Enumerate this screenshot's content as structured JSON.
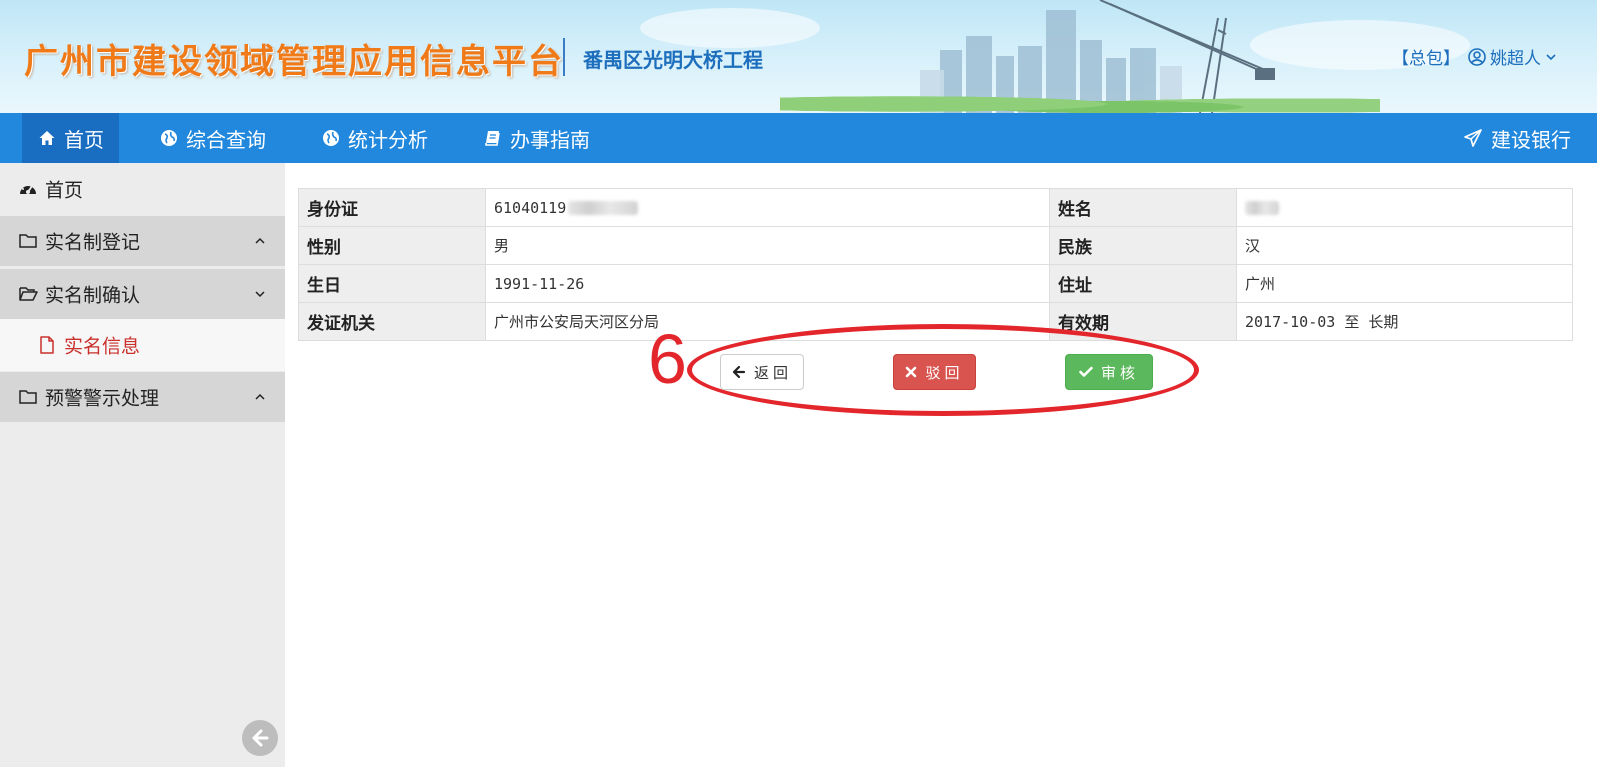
{
  "header": {
    "site_title": "广州市建设领域管理应用信息平台",
    "project_name": "番禺区光明大桥工程",
    "role_label": "【总包】",
    "user_name": "姚超人"
  },
  "topnav": {
    "items": [
      {
        "label": "首页",
        "icon": "home-icon"
      },
      {
        "label": "综合查询",
        "icon": "globe-icon"
      },
      {
        "label": "统计分析",
        "icon": "globe-icon"
      },
      {
        "label": "办事指南",
        "icon": "book-icon"
      }
    ],
    "right_label": "建设银行",
    "right_icon": "paper-plane-icon"
  },
  "sidebar": {
    "home": "首页",
    "groups": [
      {
        "label": "实名制登记"
      },
      {
        "label": "实名制确认"
      },
      {
        "label": "预警警示处理"
      }
    ],
    "sub_item": "实名信息"
  },
  "info": {
    "id_label": "身份证",
    "id_value": "61040119",
    "name_label": "姓名",
    "gender_label": "性别",
    "gender_value": "男",
    "ethnicity_label": "民族",
    "ethnicity_value": "汉",
    "birthday_label": "生日",
    "birthday_value": "1991-11-26",
    "address_label": "住址",
    "address_value": "广州",
    "issuer_label": "发证机关",
    "issuer_value": "广州市公安局天河区分局",
    "validity_label": "有效期",
    "validity_value": "2017-10-03 至 长期"
  },
  "actions": {
    "back": "返回",
    "reject": "驳回",
    "approve": "审核"
  },
  "annotation": {
    "number": "6",
    "color": "#e3262b"
  },
  "colors": {
    "nav_bg": "#2288dd",
    "nav_active": "#1a6ec2",
    "reject": "#d9534f",
    "approve": "#5cb85c",
    "title": "#f07a18"
  }
}
